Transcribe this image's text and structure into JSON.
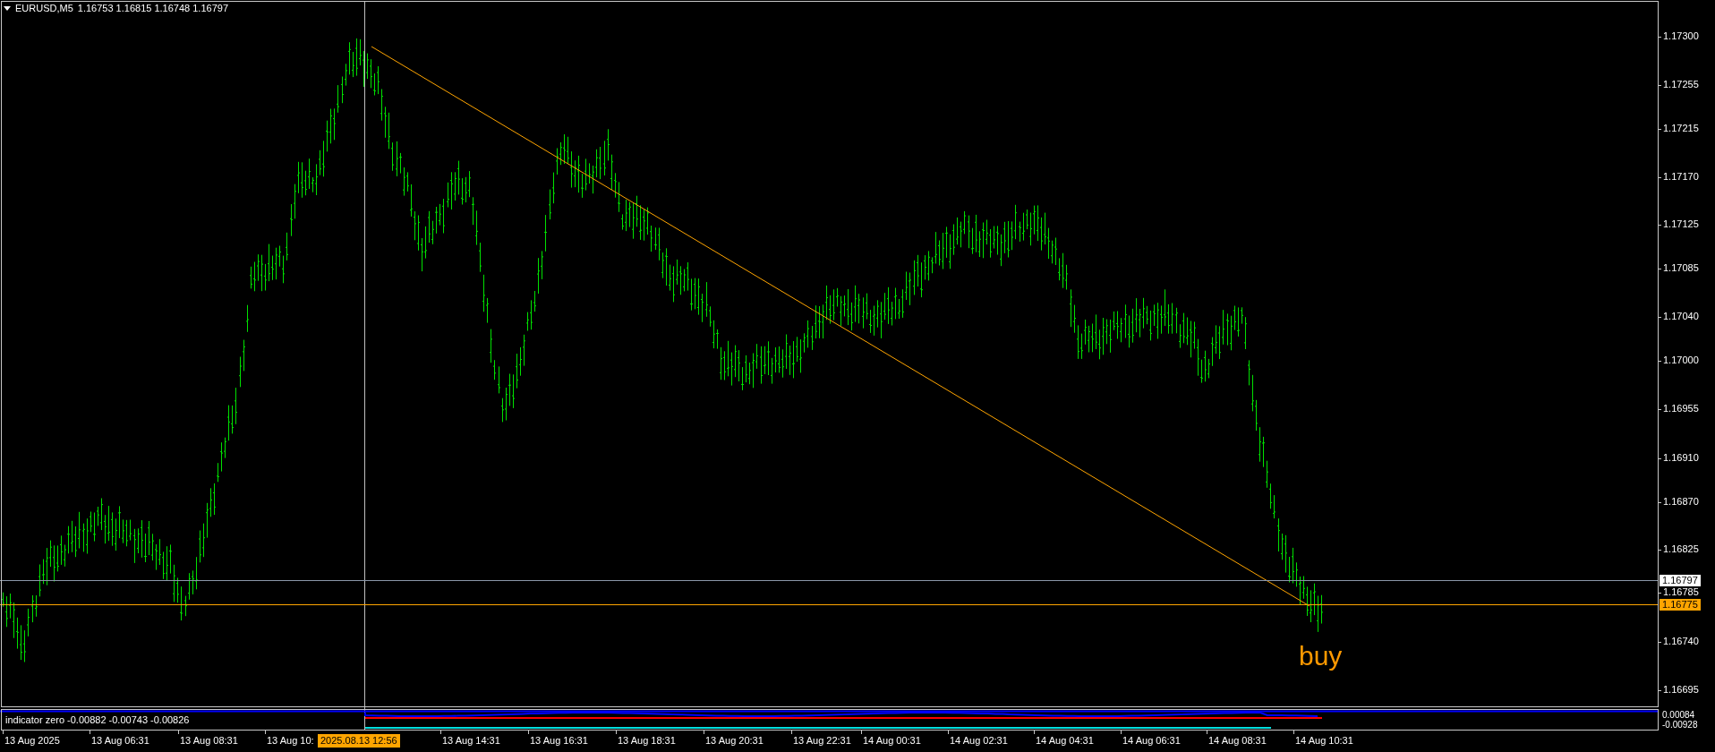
{
  "chart": {
    "symbol": "EURUSD,M5",
    "ohlc": "1.16753 1.16815 1.16748 1.16797",
    "signal": "buy"
  },
  "price_axis": {
    "labels": [
      "1.17300",
      "1.17255",
      "1.17215",
      "1.17170",
      "1.17125",
      "1.17085",
      "1.17040",
      "1.17000",
      "1.16955",
      "1.16910",
      "1.16870",
      "1.16825",
      "1.16785",
      "1.16740",
      "1.16695"
    ],
    "markers": [
      {
        "kind": "bid",
        "label": "1.16797"
      },
      {
        "kind": "line",
        "label": "1.16775"
      }
    ]
  },
  "indicator": {
    "header": "indicator zero -0.00882 -0.00743 -0.00826",
    "axis_labels": [
      "0.00084",
      "-0.00928"
    ]
  },
  "time_axis": {
    "labels": [
      "13 Aug 2025",
      "13 Aug 06:31",
      "13 Aug 08:31",
      "13 Aug 10:",
      "13 Aug 14:31",
      "13 Aug 16:31",
      "13 Aug 18:31",
      "13 Aug 20:31",
      "13 Aug 22:31",
      "14 Aug 00:31",
      "14 Aug 02:31",
      "14 Aug 04:31",
      "14 Aug 06:31",
      "14 Aug 08:31",
      "14 Aug 10:31"
    ],
    "crosshair_label": "2025.08.13 12:56"
  }
}
